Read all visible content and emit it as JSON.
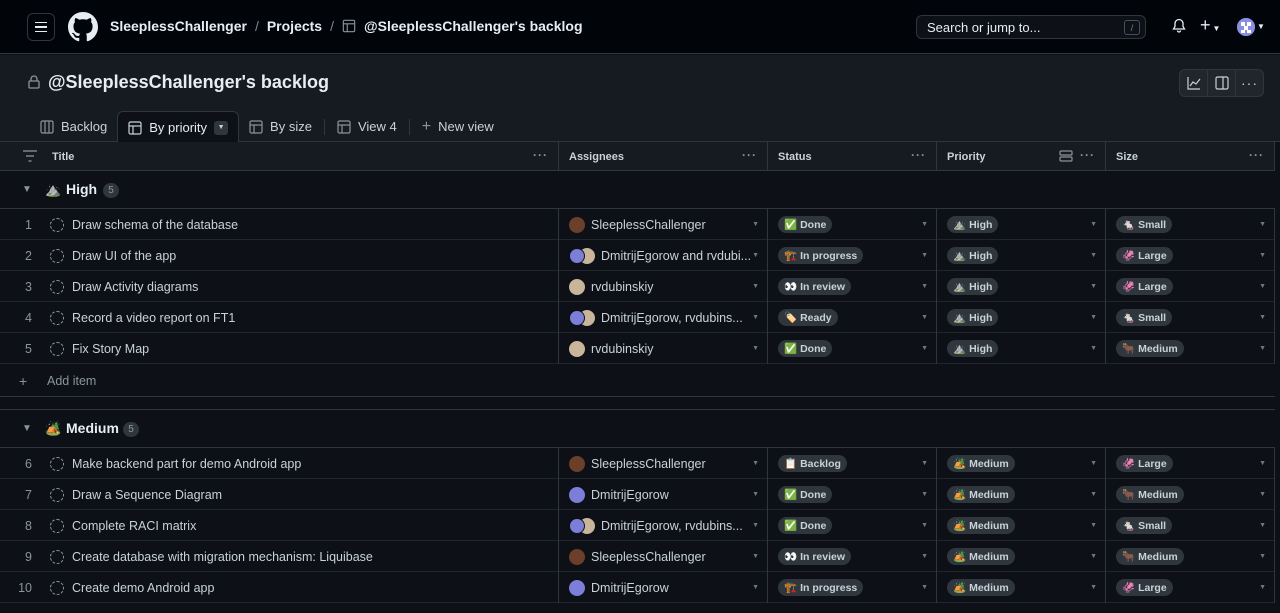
{
  "header": {
    "breadcrumb_owner": "SleeplessChallenger",
    "breadcrumb_projects": "Projects",
    "breadcrumb_project": "@SleeplessChallenger's backlog",
    "search_placeholder": "Search or jump to...",
    "search_shortcut": "/"
  },
  "project": {
    "title": "@SleeplessChallenger's backlog",
    "tabs": [
      {
        "label": "Backlog"
      },
      {
        "label": "By priority"
      },
      {
        "label": "By size"
      },
      {
        "label": "View 4"
      },
      {
        "label": "New view"
      }
    ]
  },
  "columns": {
    "title": "Title",
    "assignees": "Assignees",
    "status": "Status",
    "priority": "Priority",
    "size": "Size"
  },
  "groups": [
    {
      "emoji": "⛰️",
      "name": "High",
      "count": "5",
      "rows": [
        {
          "num": "1",
          "title": "Draw schema of the database",
          "assignee": "SleeplessChallenger",
          "status_emoji": "✅",
          "status": "Done",
          "prio_emoji": "⛰️",
          "priority": "High",
          "size_emoji": "🐁",
          "size": "Small"
        },
        {
          "num": "2",
          "title": "Draw UI of the app",
          "assignee": "DmitrijEgorow and rvdubi...",
          "status_emoji": "🏗️",
          "status": "In progress",
          "prio_emoji": "⛰️",
          "priority": "High",
          "size_emoji": "🦑",
          "size": "Large"
        },
        {
          "num": "3",
          "title": "Draw Activity diagrams",
          "assignee": "rvdubinskiy",
          "status_emoji": "👀",
          "status": "In review",
          "prio_emoji": "⛰️",
          "priority": "High",
          "size_emoji": "🦑",
          "size": "Large"
        },
        {
          "num": "4",
          "title": "Record a video report on FT1",
          "assignee": "DmitrijEgorow, rvdubins...",
          "status_emoji": "🏷️",
          "status": "Ready",
          "prio_emoji": "⛰️",
          "priority": "High",
          "size_emoji": "🐁",
          "size": "Small"
        },
        {
          "num": "5",
          "title": "Fix Story Map",
          "assignee": "rvdubinskiy",
          "status_emoji": "✅",
          "status": "Done",
          "prio_emoji": "⛰️",
          "priority": "High",
          "size_emoji": "🐂",
          "size": "Medium"
        }
      ]
    },
    {
      "emoji": "🏕️",
      "name": "Medium",
      "count": "5",
      "rows": [
        {
          "num": "6",
          "title": "Make backend part for demo Android app",
          "assignee": "SleeplessChallenger",
          "status_emoji": "📋",
          "status": "Backlog",
          "prio_emoji": "🏕️",
          "priority": "Medium",
          "size_emoji": "🦑",
          "size": "Large"
        },
        {
          "num": "7",
          "title": "Draw a Sequence Diagram",
          "assignee": "DmitrijEgorow",
          "status_emoji": "✅",
          "status": "Done",
          "prio_emoji": "🏕️",
          "priority": "Medium",
          "size_emoji": "🐂",
          "size": "Medium"
        },
        {
          "num": "8",
          "title": "Complete RACI matrix",
          "assignee": "DmitrijEgorow, rvdubins...",
          "status_emoji": "✅",
          "status": "Done",
          "prio_emoji": "🏕️",
          "priority": "Medium",
          "size_emoji": "🐁",
          "size": "Small"
        },
        {
          "num": "9",
          "title": "Create database with migration mechanism: Liquibase",
          "assignee": "SleeplessChallenger",
          "status_emoji": "👀",
          "status": "In review",
          "prio_emoji": "🏕️",
          "priority": "Medium",
          "size_emoji": "🐂",
          "size": "Medium"
        },
        {
          "num": "10",
          "title": "Create demo Android app",
          "assignee": "DmitrijEgorow",
          "status_emoji": "🏗️",
          "status": "In progress",
          "prio_emoji": "🏕️",
          "priority": "Medium",
          "size_emoji": "🦑",
          "size": "Large"
        }
      ]
    }
  ],
  "add_item_label": "Add item",
  "colors": {
    "bg": "#0d1117",
    "header": "#010409",
    "border": "#30363d",
    "text": "#e6edf3"
  }
}
